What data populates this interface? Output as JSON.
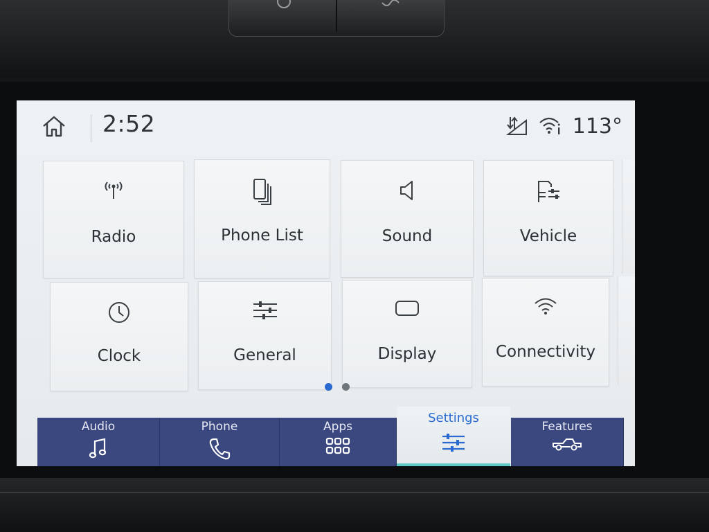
{
  "status_bar": {
    "time": "2:52",
    "temperature": "113°",
    "icons": [
      "home-icon",
      "data-transfer-icon",
      "wifi-hotspot-icon"
    ]
  },
  "settings_tiles": [
    {
      "label": "Radio",
      "icon": "radio-antenna-icon"
    },
    {
      "label": "Phone List",
      "icon": "phone-list-icon"
    },
    {
      "label": "Sound",
      "icon": "speaker-icon"
    },
    {
      "label": "Vehicle",
      "icon": "vehicle-settings-icon"
    },
    {
      "label": "Clock",
      "icon": "clock-icon"
    },
    {
      "label": "General",
      "icon": "sliders-icon"
    },
    {
      "label": "Display",
      "icon": "display-icon"
    },
    {
      "label": "Connectivity",
      "icon": "wifi-icon"
    }
  ],
  "pager": {
    "current_page": 1,
    "total_pages": 2
  },
  "nav": [
    {
      "label": "Audio",
      "icon": "music-note-icon",
      "active": false
    },
    {
      "label": "Phone",
      "icon": "phone-handset-icon",
      "active": false
    },
    {
      "label": "Apps",
      "icon": "apps-grid-icon",
      "active": false
    },
    {
      "label": "Settings",
      "icon": "settings-sliders-icon",
      "active": true
    },
    {
      "label": "Features",
      "icon": "truck-icon",
      "active": false
    }
  ],
  "colors": {
    "nav_bg": "#3b4880",
    "active_accent": "#2a6ad0",
    "active_underline": "#5fc9c8",
    "pager_active": "#2a6ad0",
    "pager_inactive": "#6f767c"
  }
}
